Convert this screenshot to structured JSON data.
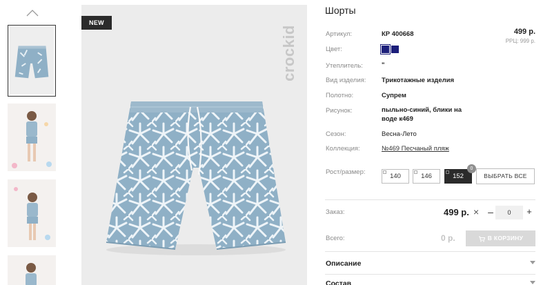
{
  "badge": "NEW",
  "brand": "crockid",
  "product": {
    "title": "Шорты",
    "price": "499 р.",
    "rrc": "РРЦ: 999 р."
  },
  "specs": [
    {
      "label": "Артикул:",
      "value": "КР 400668"
    },
    {
      "label": "Цвет:",
      "value": ""
    },
    {
      "label": "Утеплитель:",
      "value": "\""
    },
    {
      "label": "Вид изделия:",
      "value": "Трикотажные изделия"
    },
    {
      "label": "Полотно:",
      "value": "Супрем"
    },
    {
      "label": "Рисунок:",
      "value": "пыльно-синий, блики на воде к469"
    },
    {
      "label": "Сезон:",
      "value": "Весна-Лето"
    },
    {
      "label": "Коллекция:",
      "value": "№469 Песчаный пляж"
    }
  ],
  "colors": [
    "#1c1f7a",
    "#1c1f7a"
  ],
  "sizes": {
    "label": "Рост/размер:",
    "options": [
      "140",
      "146",
      "152"
    ],
    "selected": "152",
    "count": "0",
    "select_all": "ВЫБРАТЬ ВСЕ"
  },
  "order": {
    "label": "Заказ:",
    "price": "499 р.",
    "remove": "×",
    "minus": "–",
    "quantity": "0",
    "plus": "+"
  },
  "total": {
    "label": "Всего:",
    "value": "0 р.",
    "cart_button": "В КОРЗИНУ"
  },
  "accordion": [
    "Описание",
    "Состав"
  ]
}
